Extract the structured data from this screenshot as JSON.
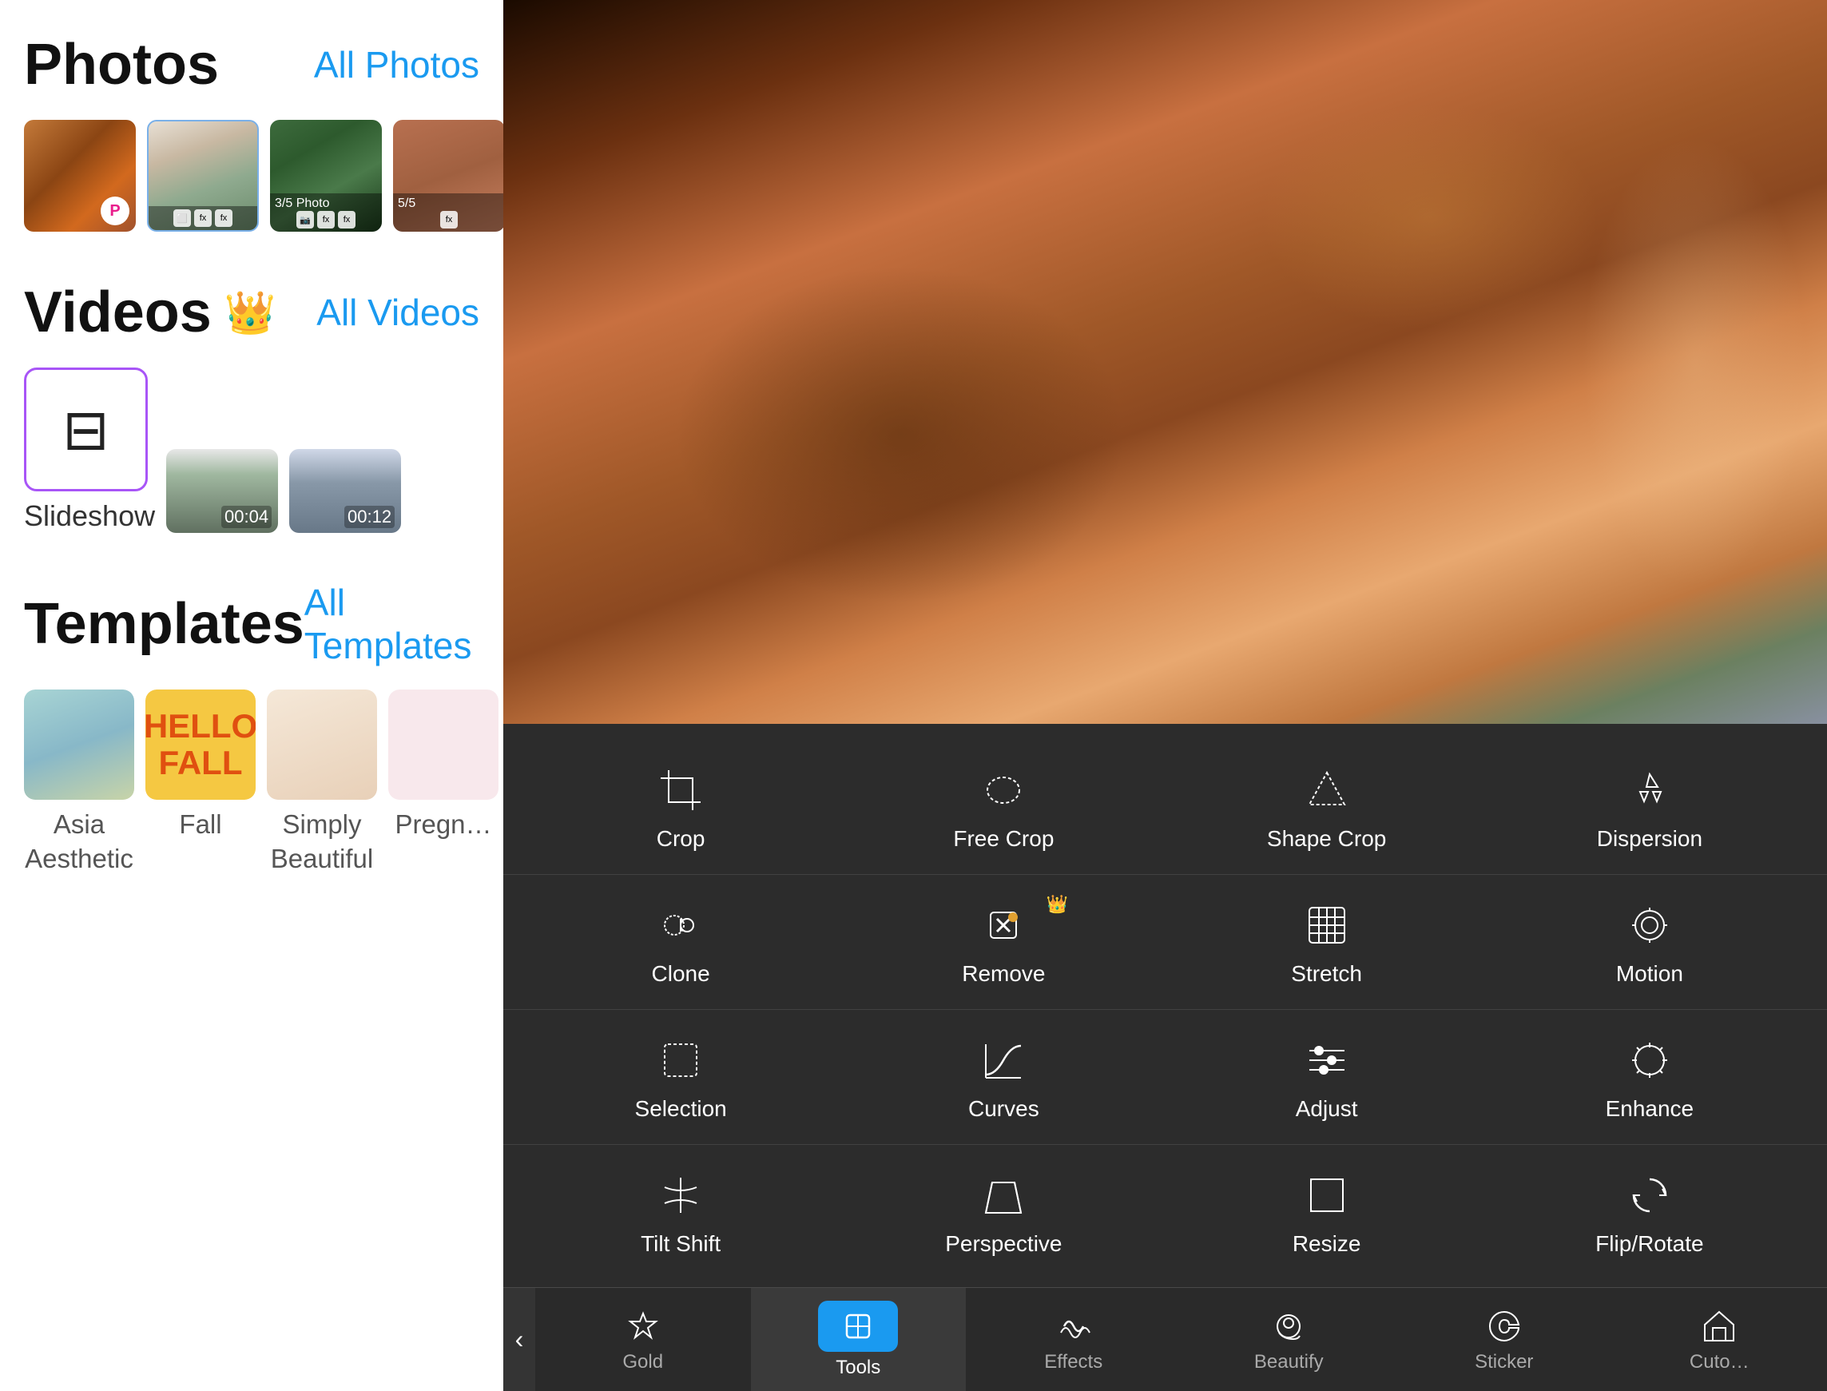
{
  "left": {
    "photos_title": "Photos",
    "photos_link": "All Photos",
    "videos_title": "Videos",
    "videos_link": "All Videos",
    "templates_title": "Templates",
    "templates_link": "All Templates",
    "slideshow_label": "Slideshow",
    "templates": [
      {
        "label": "Asia Aesthetic"
      },
      {
        "label": "Fall"
      },
      {
        "label": "Simply Beautiful"
      },
      {
        "label": "Pregn…"
      }
    ],
    "video_durations": [
      "00:04",
      "00:12"
    ]
  },
  "right": {
    "tools": [
      [
        {
          "id": "crop",
          "label": "Crop",
          "icon": "crop"
        },
        {
          "id": "free-crop",
          "label": "Free Crop",
          "icon": "free-crop"
        },
        {
          "id": "shape-crop",
          "label": "Shape Crop",
          "icon": "shape-crop"
        },
        {
          "id": "dispersion",
          "label": "Dispersion",
          "icon": "dispersion"
        }
      ],
      [
        {
          "id": "clone",
          "label": "Clone",
          "icon": "clone",
          "premium": false
        },
        {
          "id": "remove",
          "label": "Remove",
          "icon": "remove",
          "premium": true
        },
        {
          "id": "stretch",
          "label": "Stretch",
          "icon": "stretch",
          "premium": false
        },
        {
          "id": "motion",
          "label": "Motion",
          "icon": "motion",
          "premium": false
        }
      ],
      [
        {
          "id": "selection",
          "label": "Selection",
          "icon": "selection"
        },
        {
          "id": "curves",
          "label": "Curves",
          "icon": "curves"
        },
        {
          "id": "adjust",
          "label": "Adjust",
          "icon": "adjust"
        },
        {
          "id": "enhance",
          "label": "Enhance",
          "icon": "enhance"
        }
      ],
      [
        {
          "id": "tilt-shift",
          "label": "Tilt Shift",
          "icon": "tilt-shift"
        },
        {
          "id": "perspective",
          "label": "Perspective",
          "icon": "perspective"
        },
        {
          "id": "resize",
          "label": "Resize",
          "icon": "resize"
        },
        {
          "id": "flip-rotate",
          "label": "Flip/Rotate",
          "icon": "flip-rotate"
        }
      ]
    ],
    "bottom_nav": [
      {
        "id": "gold",
        "label": "Gold",
        "icon": "crown"
      },
      {
        "id": "tools",
        "label": "Tools",
        "icon": "tools",
        "active": true
      },
      {
        "id": "effects",
        "label": "Effects",
        "icon": "effects"
      },
      {
        "id": "beautify",
        "label": "Beautify",
        "icon": "beautify"
      },
      {
        "id": "sticker",
        "label": "Sticker",
        "icon": "sticker"
      },
      {
        "id": "cutout",
        "label": "Cuto…",
        "icon": "cutout"
      }
    ]
  }
}
